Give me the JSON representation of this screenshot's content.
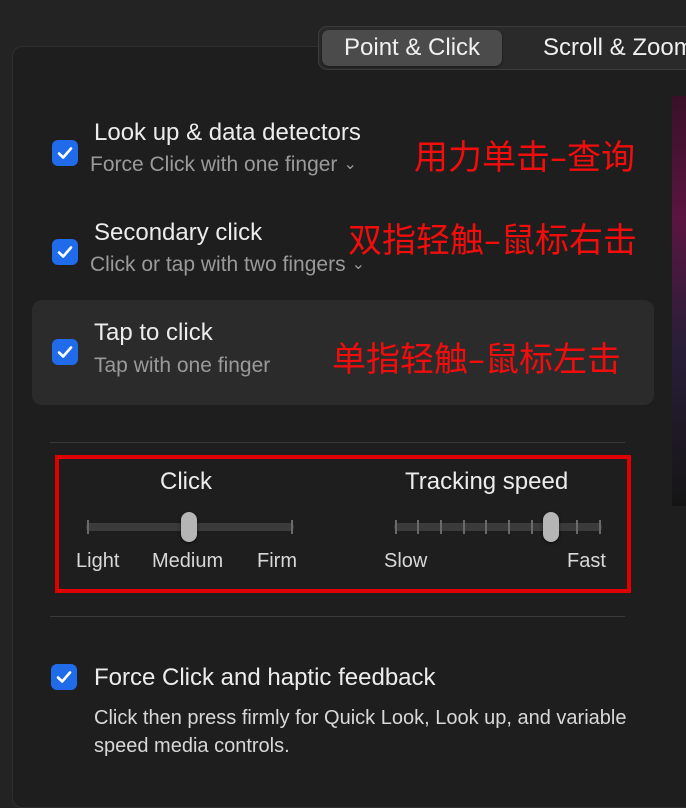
{
  "tabs": [
    {
      "label": "Point & Click",
      "active": true
    },
    {
      "label": "Scroll & Zoom",
      "active": false
    }
  ],
  "options": [
    {
      "title": "Look up & data detectors",
      "subtitle": "Force Click with one finger",
      "has_dropdown": true,
      "checked": true,
      "annotation": "用力单击–查询"
    },
    {
      "title": "Secondary click",
      "subtitle": "Click or tap with two fingers",
      "has_dropdown": true,
      "checked": true,
      "annotation": "双指轻触–鼠标右击"
    },
    {
      "title": "Tap to click",
      "subtitle": "Tap with one finger",
      "has_dropdown": false,
      "checked": true,
      "annotation": "单指轻触–鼠标左击"
    }
  ],
  "click_slider": {
    "title": "Click",
    "labels": [
      "Light",
      "Medium",
      "Firm"
    ],
    "value": "Medium",
    "position_index": 1,
    "steps": 3
  },
  "tracking_slider": {
    "title": "Tracking speed",
    "label_min": "Slow",
    "label_max": "Fast",
    "steps": 10,
    "position_index": 7
  },
  "force_click": {
    "title": "Force Click and haptic feedback",
    "checked": true,
    "description": "Click then press firmly for Quick Look, Look up, and variable speed media controls."
  },
  "colors": {
    "accent": "#1f6bea",
    "annotation": "#f20d0d",
    "highlight_box": "#e00000"
  }
}
